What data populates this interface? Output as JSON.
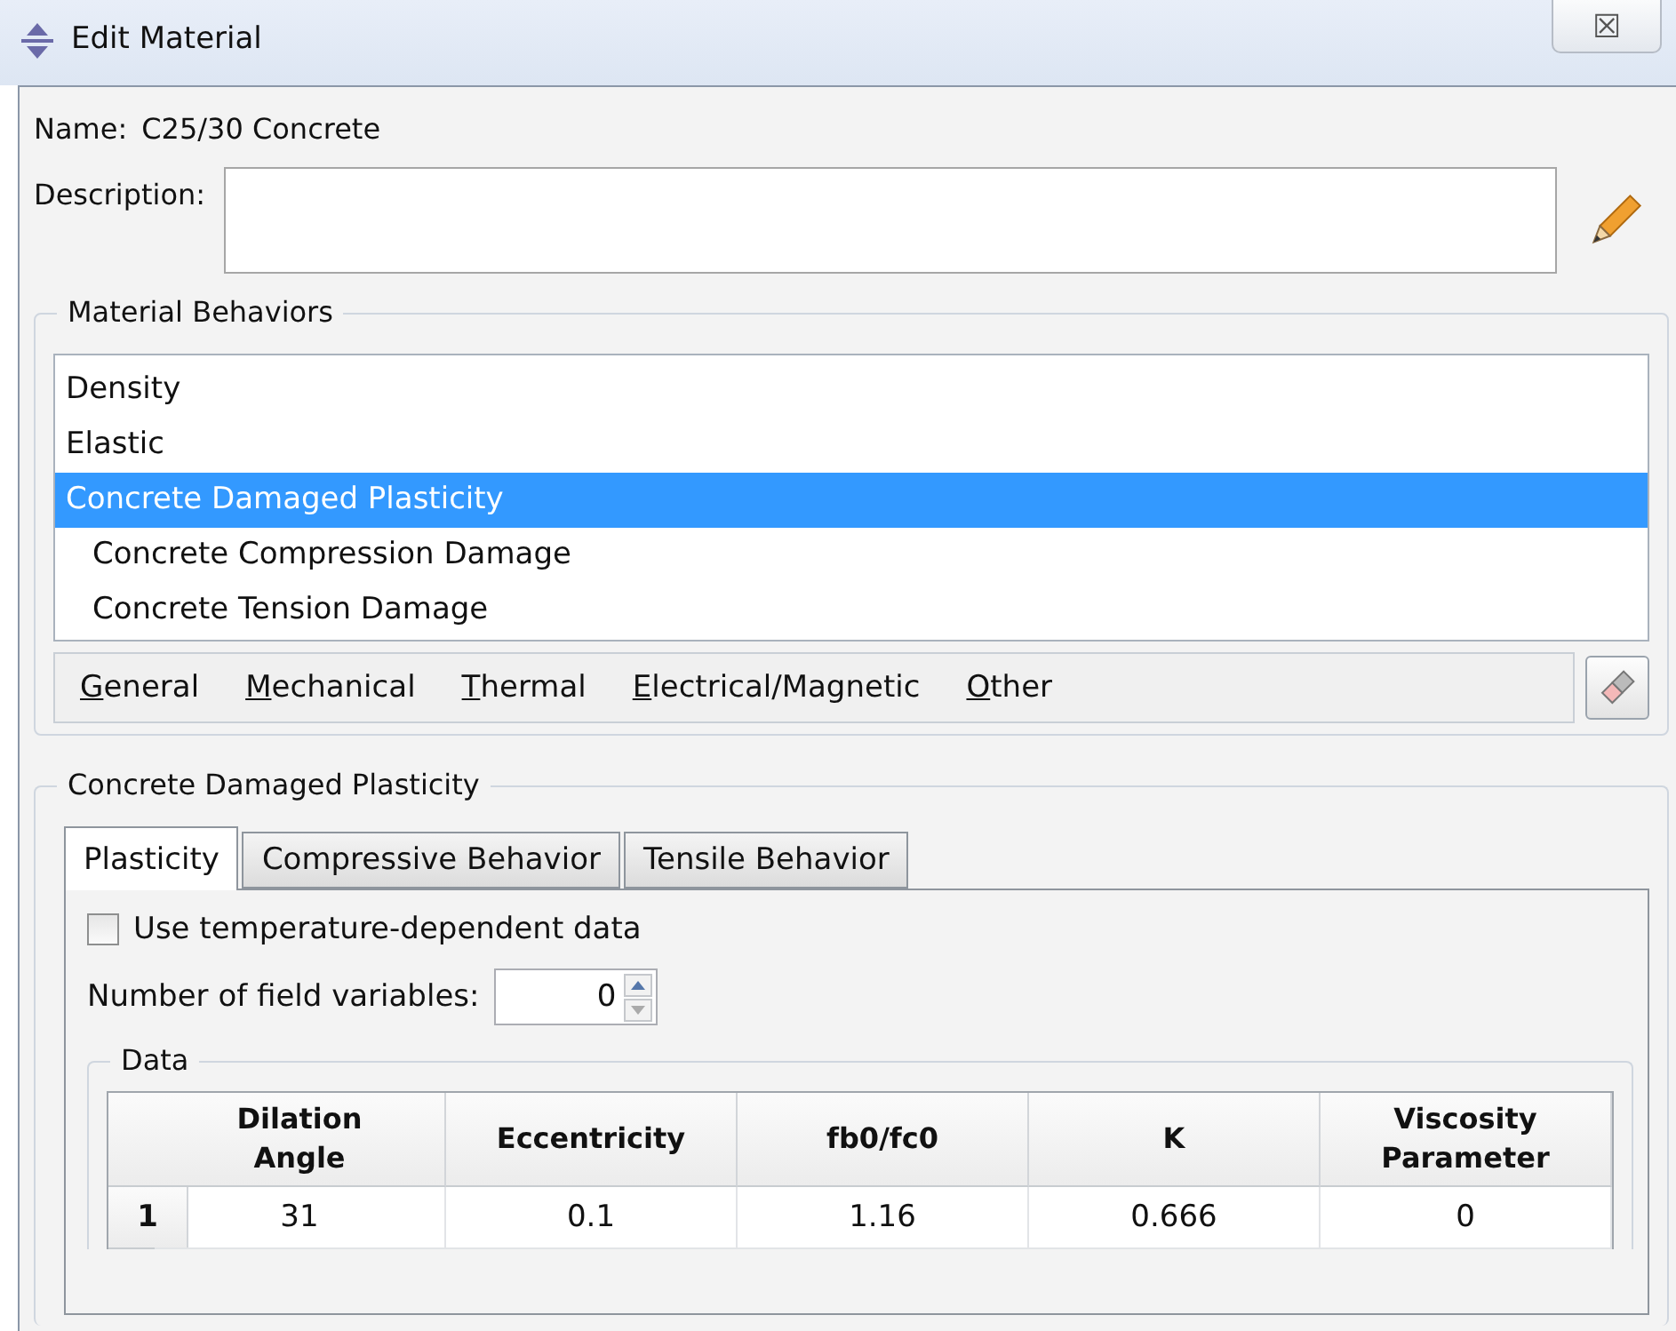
{
  "window": {
    "title": "Edit Material",
    "close": "☒"
  },
  "name": {
    "label": "Name:",
    "value": "C25/30 Concrete"
  },
  "description": {
    "label": "Description:"
  },
  "behaviors": {
    "title": "Material Behaviors",
    "items": [
      {
        "label": "Density",
        "selected": false
      },
      {
        "label": "Elastic",
        "selected": false
      },
      {
        "label": "Concrete Damaged Plasticity",
        "selected": true,
        "children": [
          {
            "label": "Concrete Compression Damage",
            "selected": false
          },
          {
            "label": "Concrete Tension Damage",
            "selected": false
          }
        ]
      }
    ]
  },
  "menu": [
    {
      "label": "General"
    },
    {
      "label": "Mechanical"
    },
    {
      "label": "Thermal"
    },
    {
      "label": "Electrical/Magnetic"
    },
    {
      "label": "Other"
    }
  ],
  "section": {
    "title": "Concrete Damaged Plasticity",
    "tabs": [
      {
        "label": "Plasticity",
        "selected": true
      },
      {
        "label": "Compressive Behavior",
        "selected": false
      },
      {
        "label": "Tensile Behavior",
        "selected": false
      }
    ],
    "temperature": {
      "label": "Use temperature-dependent data",
      "checked": false
    },
    "field_variables": {
      "label": "Number of field variables:",
      "value": "0"
    },
    "data": {
      "title": "Data",
      "columns": [
        "Dilation Angle",
        "Eccentricity",
        "fb0/fc0",
        "K",
        "Viscosity Parameter"
      ],
      "rows": [
        {
          "index": "1",
          "cells": [
            "31",
            "0.1",
            "1.16",
            "0.666",
            "0"
          ]
        }
      ]
    }
  }
}
